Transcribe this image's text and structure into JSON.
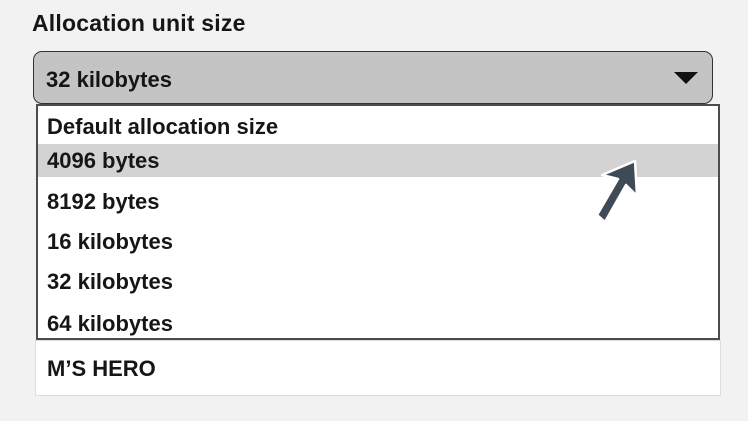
{
  "allocation": {
    "label": "Allocation unit size",
    "selected_value": "32 kilobytes",
    "options": [
      "Default allocation size",
      "4096 bytes",
      "8192 bytes",
      "16 kilobytes",
      "32 kilobytes",
      "64 kilobytes"
    ],
    "highlighted_option": "4096 bytes"
  },
  "volume_label": {
    "value": "M’S HERO"
  },
  "icons": {
    "dropdown_caret": "caret-down-icon",
    "pointer": "mouse-pointer-icon"
  },
  "colors": {
    "background": "#f2f2f2",
    "select_fill": "#c4c4c4",
    "highlight": "#d3d3d3",
    "pointer": "#3f4a57"
  }
}
